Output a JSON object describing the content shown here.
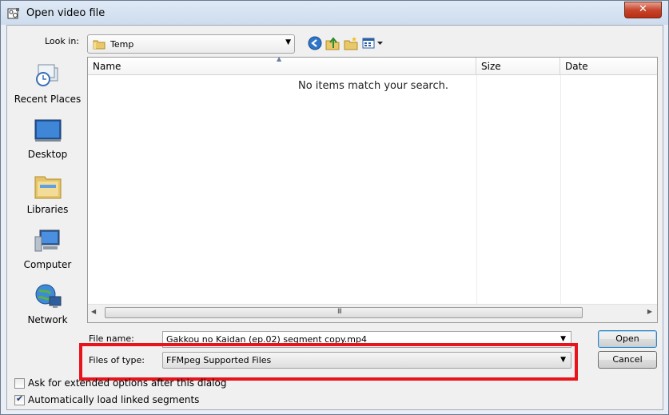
{
  "window": {
    "title": "Open video file",
    "close_glyph": "✕"
  },
  "lookin": {
    "label": "Look in:",
    "value": "Temp"
  },
  "toolbar": {
    "icons": [
      "back-icon",
      "up-folder-icon",
      "new-folder-icon",
      "view-menu-icon"
    ]
  },
  "places": [
    {
      "label": "Recent Places",
      "icon": "recent-places-icon"
    },
    {
      "label": "Desktop",
      "icon": "desktop-icon"
    },
    {
      "label": "Libraries",
      "icon": "libraries-icon"
    },
    {
      "label": "Computer",
      "icon": "computer-icon"
    },
    {
      "label": "Network",
      "icon": "network-icon"
    }
  ],
  "filelist": {
    "columns": [
      "Name",
      "Size",
      "Date"
    ],
    "empty_message": "No items match your search.",
    "scroll_grip": "III"
  },
  "filename": {
    "label": "File name:",
    "value": "Gakkou no Kaidan (ep.02) segment copy.mp4"
  },
  "filetype": {
    "label": "Files of type:",
    "value": "FFMpeg Supported Files"
  },
  "buttons": {
    "open": "Open",
    "cancel": "Cancel"
  },
  "options": [
    {
      "label": "Ask for extended options after this dialog",
      "checked": false
    },
    {
      "label": "Automatically load linked segments",
      "checked": true
    }
  ],
  "colors": {
    "highlight": "#e8141b",
    "close": "#c6452c"
  }
}
